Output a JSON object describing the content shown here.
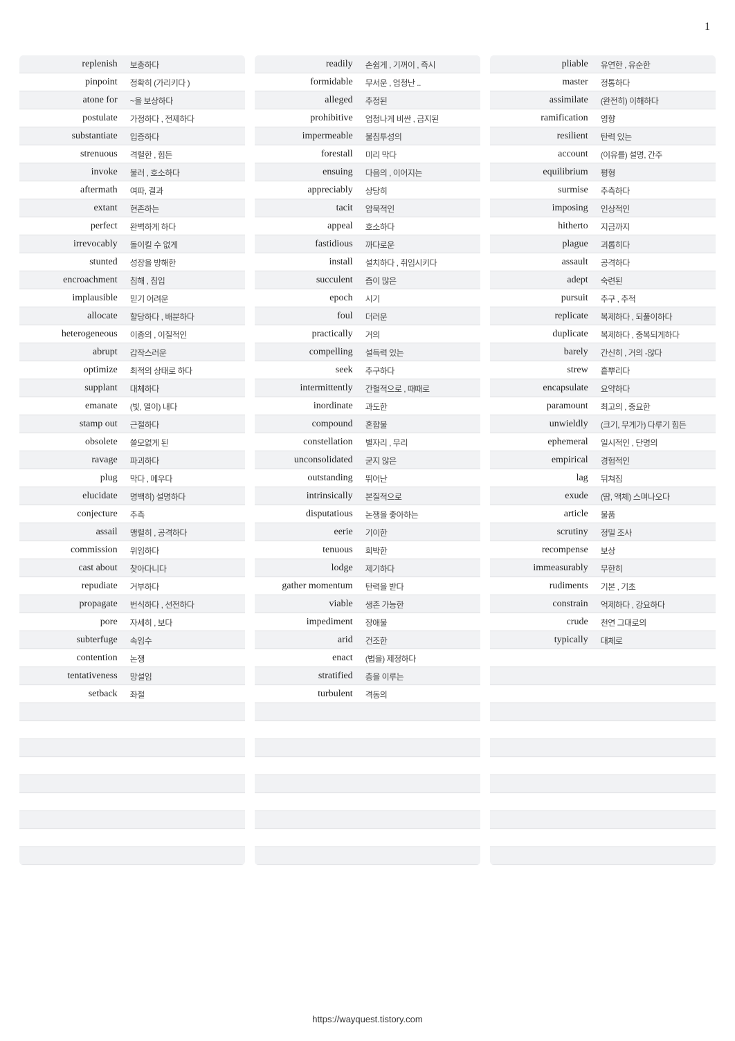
{
  "page_number": "1",
  "footer_url": "https://wayquest.tistory.com",
  "columns": [
    [
      {
        "term": "replenish",
        "def": "보충하다"
      },
      {
        "term": "pinpoint",
        "def": "정확히 (가리키다     )"
      },
      {
        "term": "atone for",
        "def": "~을 보상하다"
      },
      {
        "term": "postulate",
        "def": "가정하다 , 전제하다"
      },
      {
        "term": "substantiate",
        "def": "입증하다"
      },
      {
        "term": "strenuous",
        "def": "격렬한 , 힘든"
      },
      {
        "term": "invoke",
        "def": "불러 , 호소하다"
      },
      {
        "term": "aftermath",
        "def": "여파, 결과"
      },
      {
        "term": "extant",
        "def": "현존하는"
      },
      {
        "term": "perfect",
        "def": "완벽하게 하다"
      },
      {
        "term": "irrevocably",
        "def": "돌이킬 수 없게"
      },
      {
        "term": "stunted",
        "def": "성장을 방해한"
      },
      {
        "term": "encroachment",
        "def": "침해 , 침입"
      },
      {
        "term": "implausible",
        "def": "믿기 어려운"
      },
      {
        "term": "allocate",
        "def": "할당하다 , 배분하다"
      },
      {
        "term": "heterogeneous",
        "def": "이종의 , 이질적인"
      },
      {
        "term": "abrupt",
        "def": "갑작스러운"
      },
      {
        "term": "optimize",
        "def": "최적의 상태로 하다"
      },
      {
        "term": "supplant",
        "def": "대체하다"
      },
      {
        "term": "emanate",
        "def": "(빛, 열이) 내다"
      },
      {
        "term": "stamp out",
        "def": "근절하다"
      },
      {
        "term": "obsolete",
        "def": "쓸모없게 된"
      },
      {
        "term": "ravage",
        "def": "파괴하다"
      },
      {
        "term": "plug",
        "def": "막다 , 메우다"
      },
      {
        "term": "elucidate",
        "def": "명백히) 설명하다"
      },
      {
        "term": "conjecture",
        "def": "추측"
      },
      {
        "term": "assail",
        "def": "맹렬히 , 공격하다"
      },
      {
        "term": "commission",
        "def": "위임하다"
      },
      {
        "term": "cast about",
        "def": "찾아다니다"
      },
      {
        "term": "repudiate",
        "def": "거부하다"
      },
      {
        "term": "propagate",
        "def": "번식하다 , 선전하다"
      },
      {
        "term": "pore",
        "def": "자세히 , 보다"
      },
      {
        "term": "subterfuge",
        "def": "속임수"
      },
      {
        "term": "contention",
        "def": "논쟁"
      },
      {
        "term": "tentativeness",
        "def": "망설임"
      },
      {
        "term": "setback",
        "def": "좌절"
      },
      {
        "term": "",
        "def": ""
      },
      {
        "term": "",
        "def": ""
      },
      {
        "term": "",
        "def": ""
      },
      {
        "term": "",
        "def": ""
      },
      {
        "term": "",
        "def": ""
      },
      {
        "term": "",
        "def": ""
      },
      {
        "term": "",
        "def": ""
      },
      {
        "term": "",
        "def": ""
      },
      {
        "term": "",
        "def": ""
      }
    ],
    [
      {
        "term": "readily",
        "def": "손쉽게 , 기꺼이 , 즉시"
      },
      {
        "term": "formidable",
        "def": "무서운 , 엄청난   .."
      },
      {
        "term": "alleged",
        "def": "추정된"
      },
      {
        "term": "prohibitive",
        "def": "엄청나게 비싼 , 금지된"
      },
      {
        "term": "impermeable",
        "def": "불침투성의"
      },
      {
        "term": "forestall",
        "def": "미리 막다"
      },
      {
        "term": "ensuing",
        "def": "다음의 , 이어지는"
      },
      {
        "term": "appreciably",
        "def": "상당히"
      },
      {
        "term": "tacit",
        "def": "암묵적인"
      },
      {
        "term": "appeal",
        "def": "호소하다"
      },
      {
        "term": "fastidious",
        "def": "까다로운"
      },
      {
        "term": "install",
        "def": "설치하다 , 취임시키다"
      },
      {
        "term": "succulent",
        "def": "즙이 많은"
      },
      {
        "term": "epoch",
        "def": "시기"
      },
      {
        "term": "foul",
        "def": "더러운"
      },
      {
        "term": "practically",
        "def": "거의"
      },
      {
        "term": "compelling",
        "def": "설득력 있는"
      },
      {
        "term": "seek",
        "def": "추구하다"
      },
      {
        "term": "intermittently",
        "def": "간헐적으로 , 때때로"
      },
      {
        "term": "inordinate",
        "def": "과도한"
      },
      {
        "term": "compound",
        "def": "혼합물"
      },
      {
        "term": "constellation",
        "def": "별자리 , 무리"
      },
      {
        "term": "unconsolidated",
        "def": "굳지 않은"
      },
      {
        "term": "outstanding",
        "def": "뛰어난"
      },
      {
        "term": "intrinsically",
        "def": "본질적으로"
      },
      {
        "term": "disputatious",
        "def": "논쟁을 좋아하는"
      },
      {
        "term": "eerie",
        "def": "기이한"
      },
      {
        "term": "tenuous",
        "def": "희박한"
      },
      {
        "term": "lodge",
        "def": "제기하다"
      },
      {
        "term": "gather momentum",
        "def": "탄력을 받다"
      },
      {
        "term": "viable",
        "def": "생존 가능한"
      },
      {
        "term": "impediment",
        "def": "장애물"
      },
      {
        "term": "arid",
        "def": "건조한"
      },
      {
        "term": "enact",
        "def": "(법을) 제정하다"
      },
      {
        "term": "stratified",
        "def": "층을 이루는"
      },
      {
        "term": "turbulent",
        "def": "격동의"
      },
      {
        "term": "",
        "def": ""
      },
      {
        "term": "",
        "def": ""
      },
      {
        "term": "",
        "def": ""
      },
      {
        "term": "",
        "def": ""
      },
      {
        "term": "",
        "def": ""
      },
      {
        "term": "",
        "def": ""
      },
      {
        "term": "",
        "def": ""
      },
      {
        "term": "",
        "def": ""
      },
      {
        "term": "",
        "def": ""
      }
    ],
    [
      {
        "term": "pliable",
        "def": "유연한 , 유순한"
      },
      {
        "term": "master",
        "def": "정통하다"
      },
      {
        "term": "assimilate",
        "def": "(완전히) 이해하다"
      },
      {
        "term": "ramification",
        "def": "영향"
      },
      {
        "term": "resilient",
        "def": "탄력 있는"
      },
      {
        "term": "account",
        "def": "(이유를) 설명, 간주"
      },
      {
        "term": "equilibrium",
        "def": "평형"
      },
      {
        "term": "surmise",
        "def": "추측하다"
      },
      {
        "term": "imposing",
        "def": "인상적인"
      },
      {
        "term": "hitherto",
        "def": "지금까지"
      },
      {
        "term": "plague",
        "def": "괴롭히다"
      },
      {
        "term": "assault",
        "def": "공격하다"
      },
      {
        "term": "adept",
        "def": "숙련된"
      },
      {
        "term": "pursuit",
        "def": "추구 , 추적"
      },
      {
        "term": "replicate",
        "def": "복제하다 , 되풀이하다"
      },
      {
        "term": "duplicate",
        "def": "복제하다 , 중복되게하다"
      },
      {
        "term": "barely",
        "def": "간신히 , 거의 -않다"
      },
      {
        "term": "strew",
        "def": "흩뿌리다"
      },
      {
        "term": "encapsulate",
        "def": "요약하다"
      },
      {
        "term": "paramount",
        "def": "최고의 , 중요한"
      },
      {
        "term": "unwieldly",
        "def": "(크기, 무게가) 다루기 힘든"
      },
      {
        "term": "ephemeral",
        "def": "일시적인 , 단명의"
      },
      {
        "term": "empirical",
        "def": "경험적인"
      },
      {
        "term": "lag",
        "def": "뒤쳐짐"
      },
      {
        "term": "exude",
        "def": "(땀, 액체) 스며나오다"
      },
      {
        "term": "article",
        "def": "물품"
      },
      {
        "term": "scrutiny",
        "def": "정밀 조사"
      },
      {
        "term": "recompense",
        "def": "보상"
      },
      {
        "term": "immeasurably",
        "def": "무한히"
      },
      {
        "term": "rudiments",
        "def": "기본 , 기초"
      },
      {
        "term": "constrain",
        "def": "억제하다 , 강요하다"
      },
      {
        "term": "crude",
        "def": "천연 그대로의"
      },
      {
        "term": "typically",
        "def": "대체로"
      },
      {
        "term": "",
        "def": ""
      },
      {
        "term": "",
        "def": ""
      },
      {
        "term": "",
        "def": ""
      },
      {
        "term": "",
        "def": ""
      },
      {
        "term": "",
        "def": ""
      },
      {
        "term": "",
        "def": ""
      },
      {
        "term": "",
        "def": ""
      },
      {
        "term": "",
        "def": ""
      },
      {
        "term": "",
        "def": ""
      },
      {
        "term": "",
        "def": ""
      },
      {
        "term": "",
        "def": ""
      },
      {
        "term": "",
        "def": ""
      }
    ]
  ]
}
